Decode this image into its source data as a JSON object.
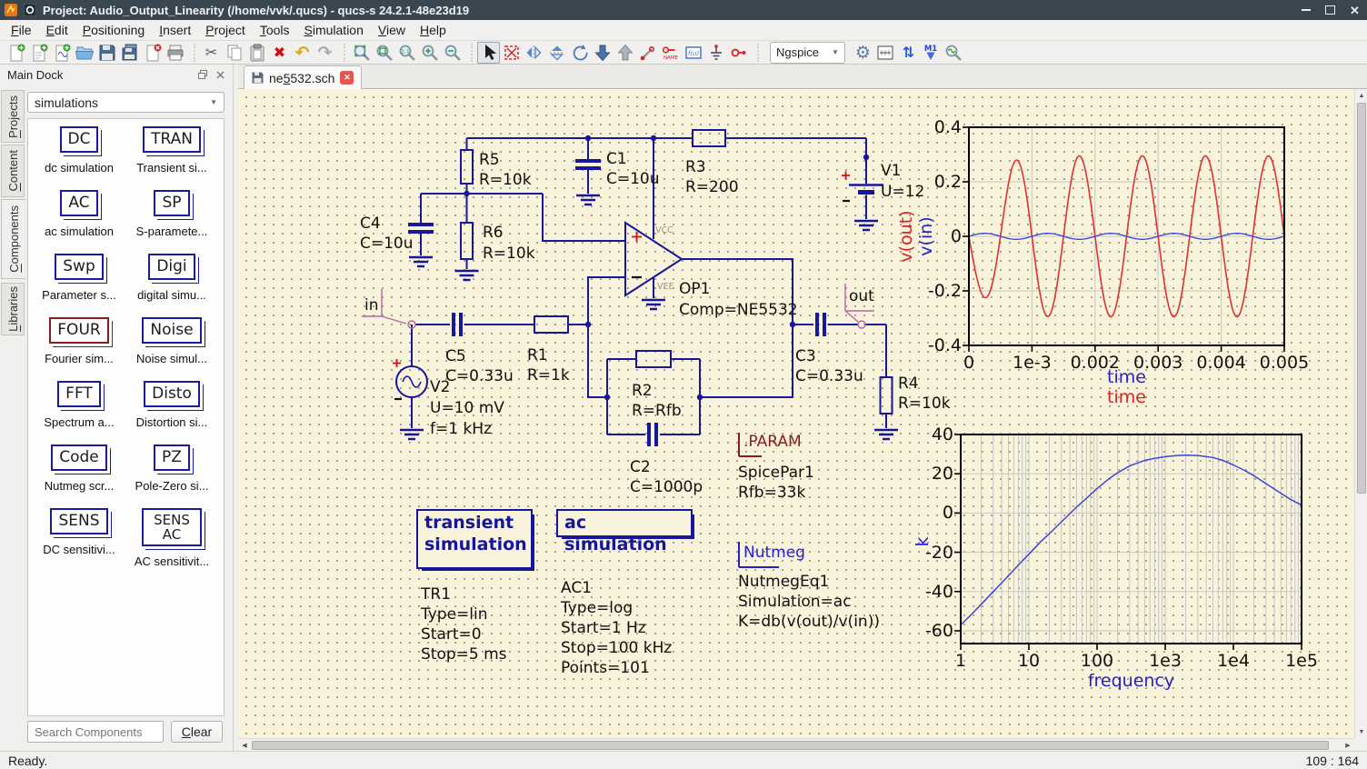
{
  "window": {
    "title": "Project: Audio_Output_Linearity (/home/vvk/.qucs) - qucs-s 24.2.1-48e23d19"
  },
  "menu": {
    "items": [
      "File",
      "Edit",
      "Positioning",
      "Insert",
      "Project",
      "Tools",
      "Simulation",
      "View",
      "Help"
    ]
  },
  "toolbar": {
    "simulator": "Ngspice",
    "glyphs": {
      "cut": "✂",
      "delete": "✖",
      "undo": "↶",
      "redo": "↷",
      "gear": "⚙",
      "exchange": "⇅",
      "marker_label": "M1",
      "name_label": "NAME",
      "one_to_one": "1:1",
      "equation": "f(u)"
    }
  },
  "tab": {
    "pre": "ne",
    "accel": "5",
    "post": "532.sch"
  },
  "dock": {
    "title": "Main Dock",
    "tabs": [
      "Projects",
      "Content",
      "Components",
      "Libraries"
    ],
    "category": "simulations",
    "items": [
      {
        "label": "DC",
        "caption": "dc simulation"
      },
      {
        "label": "TRAN",
        "caption": "Transient si..."
      },
      {
        "label": "AC",
        "caption": "ac simulation"
      },
      {
        "label": "SP",
        "caption": "S-paramete..."
      },
      {
        "label": "Swp",
        "caption": "Parameter s..."
      },
      {
        "label": "Digi",
        "caption": "digital simu..."
      },
      {
        "label": "FOUR",
        "caption": "Fourier sim...",
        "red": true
      },
      {
        "label": "Noise",
        "caption": "Noise simul..."
      },
      {
        "label": "FFT",
        "caption": "Spectrum a..."
      },
      {
        "label": "Disto",
        "caption": "Distortion si..."
      },
      {
        "label": "Code",
        "caption": "Nutmeg scr..."
      },
      {
        "label": "PZ",
        "caption": "Pole-Zero si..."
      },
      {
        "label": "SENS",
        "caption": "DC sensitivi..."
      },
      {
        "label": "SENS AC",
        "caption": "AC sensitivit..."
      }
    ],
    "search_placeholder": "Search Components",
    "clear_label": "Clear"
  },
  "schematic": {
    "r5_name": "R5",
    "r5_value": "R=10k",
    "r6_name": "R6",
    "r6_value": "R=10k",
    "c4_name": "C4",
    "c4_value": "C=10u",
    "c1_name": "C1",
    "c1_value": "C=10u",
    "r3_name": "R3",
    "r3_value": "R=200",
    "v1_name": "V1",
    "v1_value": "U=12",
    "c5_name": "C5",
    "c5_value": "C=0.33u",
    "r1_name": "R1",
    "r1_value": "R=1k",
    "v2_name": "V2",
    "v2_value": "U=10 mV",
    "v2_freq": "f=1 kHz",
    "r2_name": "R2",
    "r2_value": "R=Rfb",
    "c2_name": "C2",
    "c2_value": "C=1000p",
    "c3_name": "C3",
    "c3_value": "C=0.33u",
    "r4_name": "R4",
    "r4_value": "R=10k",
    "op1_name": "OP1",
    "op1_value": "Comp=NE5532",
    "vcc": "VCC",
    "vee": "VEE",
    "node_in": "in",
    "node_out": "out",
    "param_title": ".PARAM",
    "param_name": "SpicePar1",
    "param_value": "Rfb=33k",
    "nutmeg_title": "Nutmeg",
    "nutmeg_name": "NutmegEq1",
    "nutmeg_sim": "Simulation=ac",
    "nutmeg_eq": "K=db(v(out)/v(in))",
    "transient_box": "transient simulation",
    "tr_lines": [
      "TR1",
      "Type=lin",
      "Start=0",
      "Stop=5 ms"
    ],
    "ac_box": "ac simulation",
    "ac_lines": [
      "AC1",
      "Type=log",
      "Start=1 Hz",
      "Stop=100 kHz",
      "Points=101"
    ]
  },
  "chart_data": [
    {
      "type": "line",
      "xlim": [
        0,
        0.005
      ],
      "ylim": [
        -0.4,
        0.4
      ],
      "xticks": [
        {
          "v": 0,
          "label": "0"
        },
        {
          "v": 0.001,
          "label": "1e-3"
        },
        {
          "v": 0.002,
          "label": "0.002"
        },
        {
          "v": 0.003,
          "label": "0.003"
        },
        {
          "v": 0.004,
          "label": "0.004"
        },
        {
          "v": 0.005,
          "label": "0.005"
        }
      ],
      "yticks": [
        {
          "v": 0.4,
          "label": "0.4"
        },
        {
          "v": 0.2,
          "label": "0.2"
        },
        {
          "v": 0,
          "label": "0"
        },
        {
          "v": -0.2,
          "label": "-0.2"
        },
        {
          "v": -0.4,
          "label": "-0.4"
        }
      ],
      "xlabel": [
        {
          "text": "time",
          "color": "#2222cc"
        },
        {
          "text": "time",
          "color": "#d82222"
        }
      ],
      "ylabel": [
        {
          "text": "v(out)",
          "color": "#d82222"
        },
        {
          "text": "v(in)",
          "color": "#2222cc"
        }
      ],
      "grid_x": [
        0.001,
        0.002,
        0.003,
        0.004
      ],
      "grid_y": [
        0.2,
        0,
        -0.2
      ],
      "series": [
        {
          "name": "v(out)",
          "color": "#e03232",
          "waveform": "sine",
          "freq_hz": 1000,
          "steady_amplitude": 0.295,
          "initial_amplitude": 0.21,
          "inverted": true,
          "width": 1.6
        },
        {
          "name": "v(in)",
          "color": "#3a46d8",
          "waveform": "sine",
          "freq_hz": 1000,
          "steady_amplitude": 0.011,
          "initial_amplitude": 0.011,
          "inverted": false,
          "width": 1.3
        }
      ]
    },
    {
      "type": "line",
      "xscale": "log",
      "xlim": [
        1,
        100000
      ],
      "ylim": [
        -66.5,
        40
      ],
      "xticks": [
        {
          "v": 1,
          "label": "1"
        },
        {
          "v": 10,
          "label": "10"
        },
        {
          "v": 100,
          "label": "100"
        },
        {
          "v": 1000,
          "label": "1e3"
        },
        {
          "v": 10000,
          "label": "1e4"
        },
        {
          "v": 100000,
          "label": "1e5"
        }
      ],
      "yticks": [
        {
          "v": 40,
          "label": "40"
        },
        {
          "v": 20,
          "label": "20"
        },
        {
          "v": 0,
          "label": "0"
        },
        {
          "v": -20,
          "label": "-20"
        },
        {
          "v": -40,
          "label": "-40"
        },
        {
          "v": -60,
          "label": "-60"
        }
      ],
      "xlabel": [
        {
          "text": "frequency",
          "color": "#2222cc"
        }
      ],
      "ylabel": [
        {
          "text": "k",
          "color": "#2222cc"
        }
      ],
      "grid_y": [
        20,
        0,
        -20,
        -40,
        -60
      ],
      "series": [
        {
          "name": "k",
          "color": "#3a46d8",
          "width": 1.5,
          "points": [
            [
              1,
              -57
            ],
            [
              1.5,
              -51
            ],
            [
              2,
              -46.5
            ],
            [
              3,
              -40
            ],
            [
              4,
              -35.5
            ],
            [
              5,
              -32
            ],
            [
              7,
              -26.5
            ],
            [
              10,
              -21
            ],
            [
              15,
              -14.5
            ],
            [
              20,
              -10.5
            ],
            [
              30,
              -4.5
            ],
            [
              50,
              3
            ],
            [
              70,
              7.5
            ],
            [
              100,
              12.5
            ],
            [
              150,
              17.5
            ],
            [
              200,
              20.5
            ],
            [
              300,
              24
            ],
            [
              500,
              26.8
            ],
            [
              700,
              27.8
            ],
            [
              1000,
              28.7
            ],
            [
              1500,
              29.3
            ],
            [
              2000,
              29.5
            ],
            [
              3000,
              29.3
            ],
            [
              5000,
              28.3
            ],
            [
              7000,
              26.8
            ],
            [
              10000,
              24.5
            ],
            [
              15000,
              21.5
            ],
            [
              20000,
              19
            ],
            [
              30000,
              15
            ],
            [
              50000,
              10
            ],
            [
              70000,
              6.8
            ],
            [
              100000,
              4
            ]
          ]
        }
      ]
    }
  ],
  "status": {
    "left": "Ready.",
    "right": "109 : 164"
  },
  "colors": {
    "schematic": "#17179c",
    "canvas_bg": "#f8f3da",
    "directive_red": "#8c1c1c",
    "directive_blue": "#2222cc",
    "node_label_pink": "#b565a7"
  }
}
